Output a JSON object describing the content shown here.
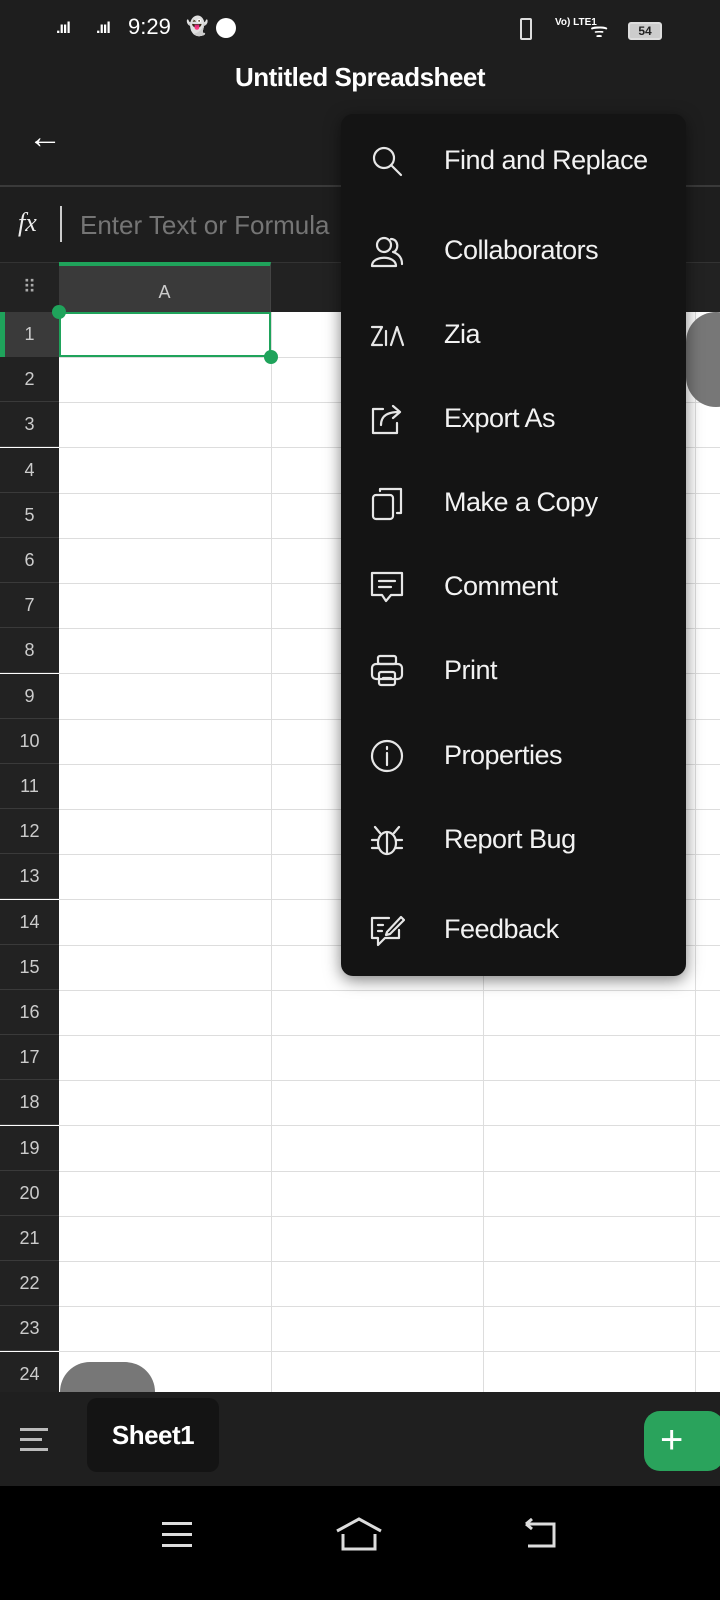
{
  "status_bar": {
    "time": "9:29",
    "battery": "54",
    "network": "Vo) LTE1"
  },
  "header": {
    "title": "Untitled Spreadsheet"
  },
  "formula_bar": {
    "fx_label": "fx",
    "placeholder": "Enter Text or Formula",
    "value": ""
  },
  "grid": {
    "columns": [
      "A"
    ],
    "rows": [
      "1",
      "2",
      "3",
      "4",
      "5",
      "6",
      "7",
      "8",
      "9",
      "10",
      "11",
      "12",
      "13",
      "14",
      "15",
      "16",
      "17",
      "18",
      "19",
      "20",
      "21",
      "22",
      "23",
      "24"
    ],
    "selected_cell": "A1"
  },
  "menu": {
    "items": [
      {
        "label": "Find and Replace",
        "icon": "search-icon"
      },
      {
        "label": "Collaborators",
        "icon": "users-icon"
      },
      {
        "label": "Zia",
        "icon": "zia-icon"
      },
      {
        "label": "Export As",
        "icon": "export-icon"
      },
      {
        "label": "Make a Copy",
        "icon": "copy-icon"
      },
      {
        "label": "Comment",
        "icon": "comment-icon"
      },
      {
        "label": "Print",
        "icon": "print-icon"
      },
      {
        "label": "Properties",
        "icon": "info-icon"
      },
      {
        "label": "Report Bug",
        "icon": "bug-icon"
      },
      {
        "label": "Feedback",
        "icon": "feedback-icon"
      }
    ]
  },
  "sheets": {
    "tabs": [
      "Sheet1"
    ],
    "add": "+"
  },
  "colors": {
    "accent": "#1fa35b",
    "add_button": "#2aa35c",
    "background": "#1e1e1e",
    "menu": "#141414"
  }
}
